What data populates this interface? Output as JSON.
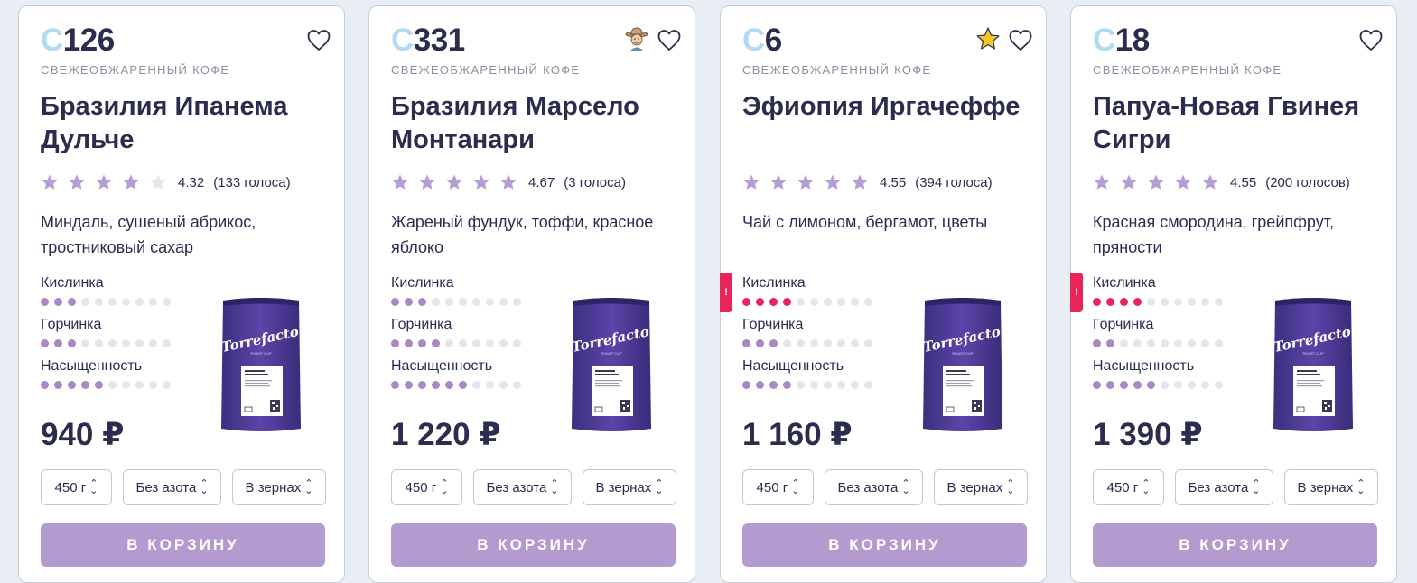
{
  "currency": "₽",
  "colors": {
    "accent": "#b39bd0",
    "star_on": "#b59dd6",
    "star_off": "#e5e5ea",
    "warn": "#e8245a",
    "code_c": "#b2dbf3"
  },
  "cards": [
    {
      "code_prefix": "С",
      "code_num": "126",
      "subtitle": "СВЕЖЕОБЖАРЕННЫЙ КОФЕ",
      "title": "Бразилия Ипанема Дульче",
      "badge": null,
      "rating": "4.32",
      "votes": "(133 голоса)",
      "stars_filled": 4,
      "description": "Миндаль, сушеный абрикос, тростниковый сахар",
      "acidity_warning": false,
      "params": [
        {
          "label": "Кислинка",
          "level": 3
        },
        {
          "label": "Горчинка",
          "level": 3
        },
        {
          "label": "Насыщенность",
          "level": 5
        }
      ],
      "price": "940 ₽",
      "weight": "450 г",
      "nitro": "Без азота",
      "grind": "В зернах",
      "button": "В КОРЗИНУ",
      "bag_lines": [
        "Бразилия",
        "Ипанема Дульче"
      ]
    },
    {
      "code_prefix": "С",
      "code_num": "331",
      "subtitle": "СВЕЖЕОБЖАРЕННЫЙ КОФЕ",
      "title": "Бразилия Марсело Монтанари",
      "badge": "farmer-icon",
      "rating": "4.67",
      "votes": "(3 голоса)",
      "stars_filled": 5,
      "description": "Жареный фундук, тоффи, красное яблоко",
      "acidity_warning": false,
      "params": [
        {
          "label": "Кислинка",
          "level": 3
        },
        {
          "label": "Горчинка",
          "level": 4
        },
        {
          "label": "Насыщенность",
          "level": 6
        }
      ],
      "price": "1 220 ₽",
      "weight": "450 г",
      "nitro": "Без азота",
      "grind": "В зернах",
      "button": "В КОРЗИНУ",
      "bag_lines": [
        "Бразилия",
        "Марсело",
        "Монтанари"
      ]
    },
    {
      "code_prefix": "С",
      "code_num": "6",
      "subtitle": "СВЕЖЕОБЖАРЕННЫЙ КОФЕ",
      "title": "Эфиопия Иргачеффе",
      "badge": "star-badge-icon",
      "rating": "4.55",
      "votes": "(394 голоса)",
      "stars_filled": 5,
      "description": "Чай с лимоном, бергамот, цветы",
      "acidity_warning": true,
      "params": [
        {
          "label": "Кислинка",
          "level": 4
        },
        {
          "label": "Горчинка",
          "level": 3
        },
        {
          "label": "Насыщенность",
          "level": 4
        }
      ],
      "price": "1 160 ₽",
      "weight": "450 г",
      "nitro": "Без азота",
      "grind": "В зернах",
      "button": "В КОРЗИНУ",
      "bag_lines": [
        "Эфиопия",
        "Иргачеффе"
      ]
    },
    {
      "code_prefix": "С",
      "code_num": "18",
      "subtitle": "СВЕЖЕОБЖАРЕННЫЙ КОФЕ",
      "title": "Папуа-Новая Гвинея Сигри",
      "badge": null,
      "rating": "4.55",
      "votes": "(200 голосов)",
      "stars_filled": 5,
      "description": "Красная смородина, грейпфрут, пряности",
      "acidity_warning": true,
      "params": [
        {
          "label": "Кислинка",
          "level": 4
        },
        {
          "label": "Горчинка",
          "level": 2
        },
        {
          "label": "Насыщенность",
          "level": 5
        }
      ],
      "price": "1 390 ₽",
      "weight": "450 г",
      "nitro": "Без азота",
      "grind": "В зернах",
      "button": "В КОРЗИНУ",
      "bag_lines": [
        "Папуа-Новая",
        "Гвинея Сигри"
      ]
    }
  ]
}
